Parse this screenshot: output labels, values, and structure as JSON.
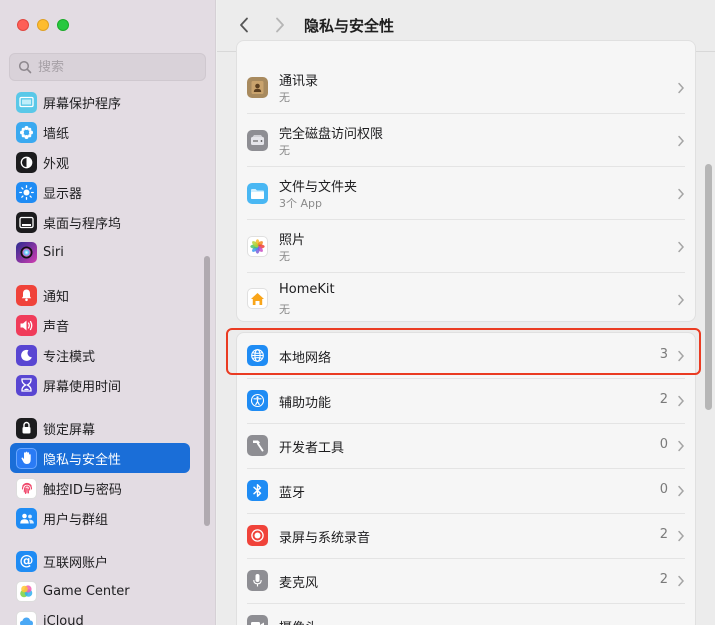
{
  "window": {
    "title": "隐私与安全性"
  },
  "search": {
    "placeholder": "搜索"
  },
  "sidebar": {
    "items": [
      {
        "label": "屏幕保护程序",
        "icon": "screensaver-icon",
        "color": "#5ac8e8"
      },
      {
        "label": "墙纸",
        "icon": "wallpaper-icon",
        "color": "#3aa9f0"
      },
      {
        "label": "外观",
        "icon": "appearance-icon",
        "color": "#1c1c1e"
      },
      {
        "label": "显示器",
        "icon": "display-icon",
        "color": "#1f8cf4"
      },
      {
        "label": "桌面与程序坞",
        "icon": "dock-icon",
        "color": "#1c1c1e"
      },
      {
        "label": "Siri",
        "icon": "siri-icon",
        "color": "#5b4ce0"
      },
      {
        "label": "通知",
        "icon": "notifications-icon",
        "color": "#f0433a"
      },
      {
        "label": "声音",
        "icon": "sound-icon",
        "color": "#f03c5a"
      },
      {
        "label": "专注模式",
        "icon": "focus-icon",
        "color": "#5946d2"
      },
      {
        "label": "屏幕使用时间",
        "icon": "screen-time-icon",
        "color": "#5946d2"
      },
      {
        "label": "锁定屏幕",
        "icon": "lock-icon",
        "color": "#1c1c1e"
      },
      {
        "label": "隐私与安全性",
        "icon": "hand-icon",
        "color": "#2a7bf5"
      },
      {
        "label": "触控ID与密码",
        "icon": "fingerprint-icon",
        "color": "#ffffff"
      },
      {
        "label": "用户与群组",
        "icon": "users-icon",
        "color": "#1f8cf4"
      },
      {
        "label": "互联网账户",
        "icon": "at-icon",
        "color": "#1f8cf4"
      },
      {
        "label": "Game Center",
        "icon": "game-center-icon",
        "color": "#ffffff"
      },
      {
        "label": "iCloud",
        "icon": "icloud-icon",
        "color": "#ffffff"
      }
    ]
  },
  "main": {
    "top_group": [
      {
        "title": "通讯录",
        "sub": "无",
        "icon": "contacts-icon"
      },
      {
        "title": "完全磁盘访问权限",
        "sub": "无",
        "icon": "disk-icon"
      },
      {
        "title": "文件与文件夹",
        "sub": "3个 App",
        "icon": "folder-icon"
      },
      {
        "title": "照片",
        "sub": "无",
        "icon": "photos-icon"
      },
      {
        "title": "HomeKit",
        "sub": "无",
        "icon": "home-icon"
      }
    ],
    "bottom_group": [
      {
        "title": "本地网络",
        "count": "3",
        "icon": "globe-icon"
      },
      {
        "title": "辅助功能",
        "count": "2",
        "icon": "accessibility-icon"
      },
      {
        "title": "开发者工具",
        "count": "0",
        "icon": "hammer-icon"
      },
      {
        "title": "蓝牙",
        "count": "0",
        "icon": "bluetooth-icon"
      },
      {
        "title": "录屏与系统录音",
        "count": "2",
        "icon": "record-icon"
      },
      {
        "title": "麦克风",
        "count": "2",
        "icon": "microphone-icon"
      },
      {
        "title": "摄像头",
        "count": "",
        "icon": "camera-icon"
      }
    ]
  }
}
